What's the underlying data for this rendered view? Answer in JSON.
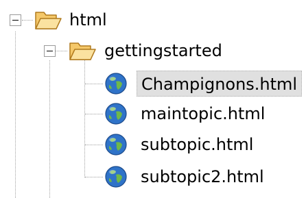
{
  "tree": {
    "root": {
      "label": "html",
      "icon": "folder-open-icon",
      "expanded": true
    },
    "child": {
      "label": "gettingstarted",
      "icon": "folder-open-icon",
      "expanded": true
    },
    "files": [
      {
        "label": "Champignons.html",
        "icon": "globe-icon",
        "selected": true
      },
      {
        "label": "maintopic.html",
        "icon": "globe-icon",
        "selected": false
      },
      {
        "label": "subtopic.html",
        "icon": "globe-icon",
        "selected": false
      },
      {
        "label": "subtopic2.html",
        "icon": "globe-icon",
        "selected": false
      }
    ]
  },
  "colors": {
    "folder_fill": "#f5c86a",
    "folder_stroke": "#b07a1e",
    "selection_bg": "#e0e0e0",
    "guide_line": "#a0a0a0"
  }
}
